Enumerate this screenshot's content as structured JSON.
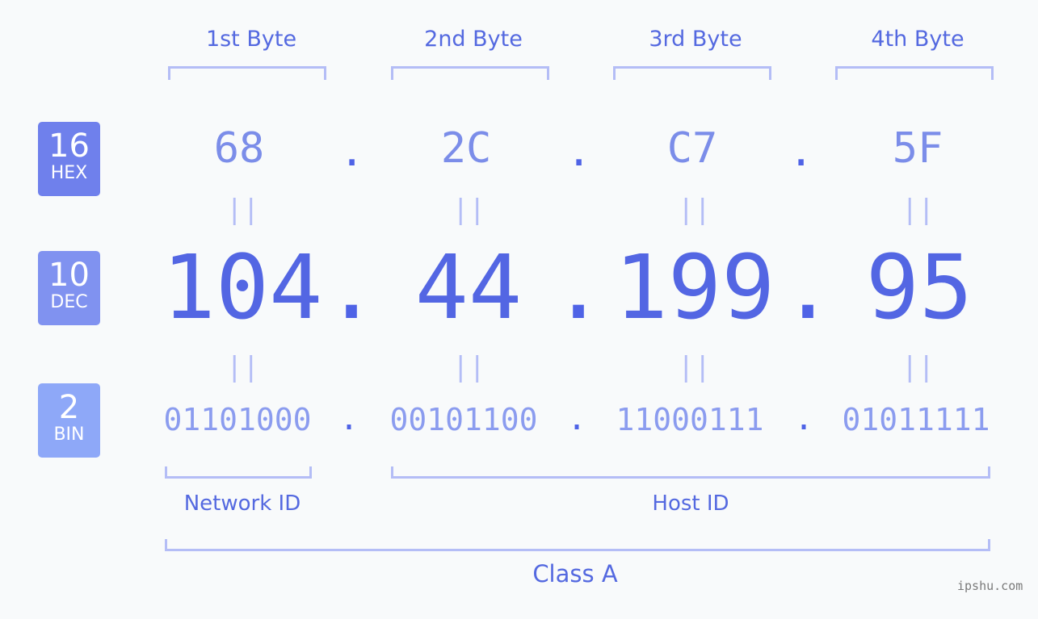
{
  "byte_headers": [
    "1st Byte",
    "2nd Byte",
    "3rd Byte",
    "4th Byte"
  ],
  "badges": [
    {
      "num": "16",
      "label": "HEX",
      "color": "#6f80ec"
    },
    {
      "num": "10",
      "label": "DEC",
      "color": "#8092f0"
    },
    {
      "num": "2",
      "label": "BIN",
      "color": "#8ea8f8"
    }
  ],
  "hex": [
    "68",
    "2C",
    "C7",
    "5F"
  ],
  "dec": [
    "104",
    "44",
    "199",
    "95"
  ],
  "bin": [
    "01101000",
    "00101100",
    "11000111",
    "01011111"
  ],
  "separator": ".",
  "equals": "||",
  "network_id_label": "Network ID",
  "host_id_label": "Host ID",
  "class_label": "Class A",
  "footer": "ipshu.com"
}
